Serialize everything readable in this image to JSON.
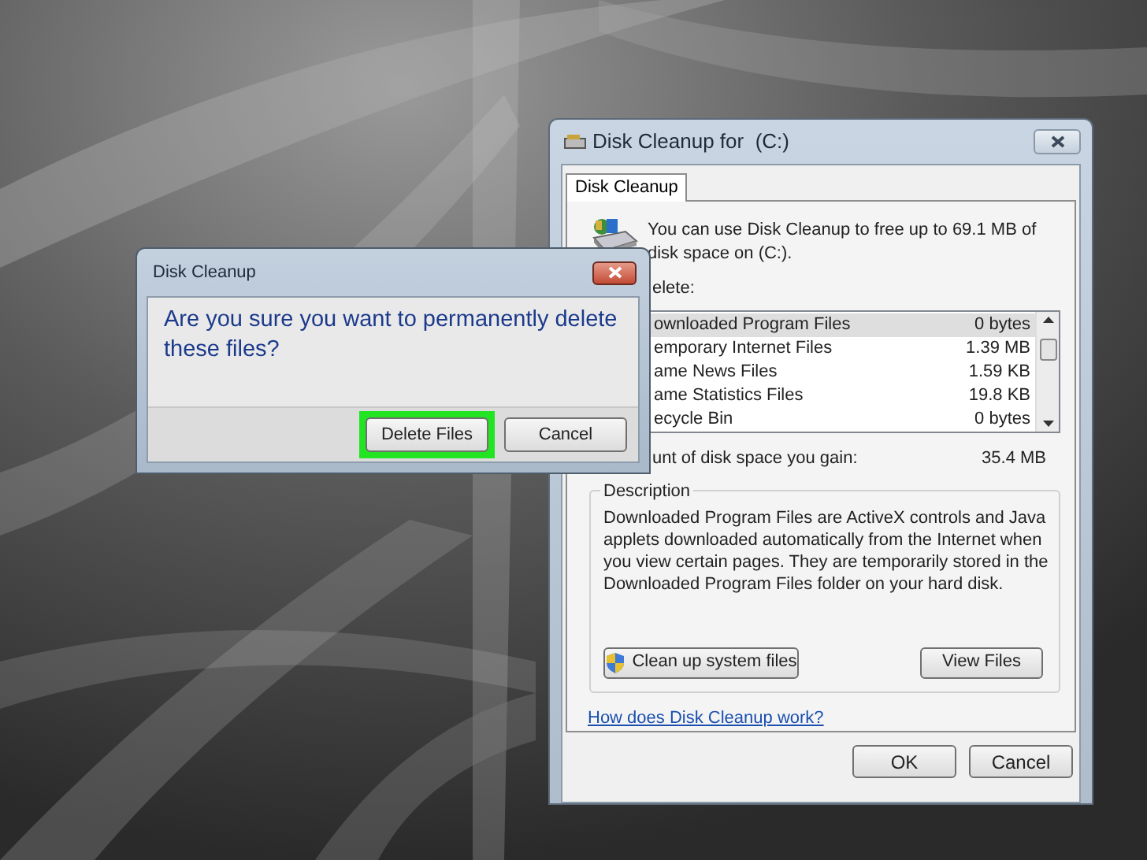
{
  "main_window": {
    "title": "Disk Cleanup for  (C:)",
    "tabs": [
      {
        "label": "Disk Cleanup",
        "selected": true
      }
    ],
    "intro": "You can use Disk Cleanup to free up to 69.1 MB of disk space on  (C:).",
    "list_label": "elete:",
    "files": [
      {
        "name": "ownloaded Program Files",
        "size": "0 bytes",
        "selected": true
      },
      {
        "name": "emporary Internet Files",
        "size": "1.39 MB",
        "selected": false
      },
      {
        "name": "ame News Files",
        "size": "1.59 KB",
        "selected": false
      },
      {
        "name": "ame Statistics Files",
        "size": "19.8 KB",
        "selected": false
      },
      {
        "name": "ecycle Bin",
        "size": "0 bytes",
        "selected": false
      }
    ],
    "gain_label": "unt of disk space you gain:",
    "gain_value": "35.4 MB",
    "description": {
      "legend": "Description",
      "text": "Downloaded Program Files are ActiveX controls and Java applets downloaded automatically from the Internet when you view certain pages. They are temporarily stored in the Downloaded Program Files folder on your hard disk."
    },
    "buttons": [
      {
        "label": "Clean up system files",
        "kind": "shield"
      },
      {
        "label": "View Files",
        "kind": "plain"
      }
    ],
    "help_link": "How does Disk Cleanup work?",
    "footer_buttons": [
      "OK",
      "Cancel"
    ]
  },
  "dialog": {
    "title": "Disk Cleanup",
    "message": "Are you sure you want to permanently delete these files?",
    "buttons": [
      {
        "label": "Delete Files",
        "highlighted": true
      },
      {
        "label": "Cancel",
        "highlighted": false
      }
    ]
  }
}
